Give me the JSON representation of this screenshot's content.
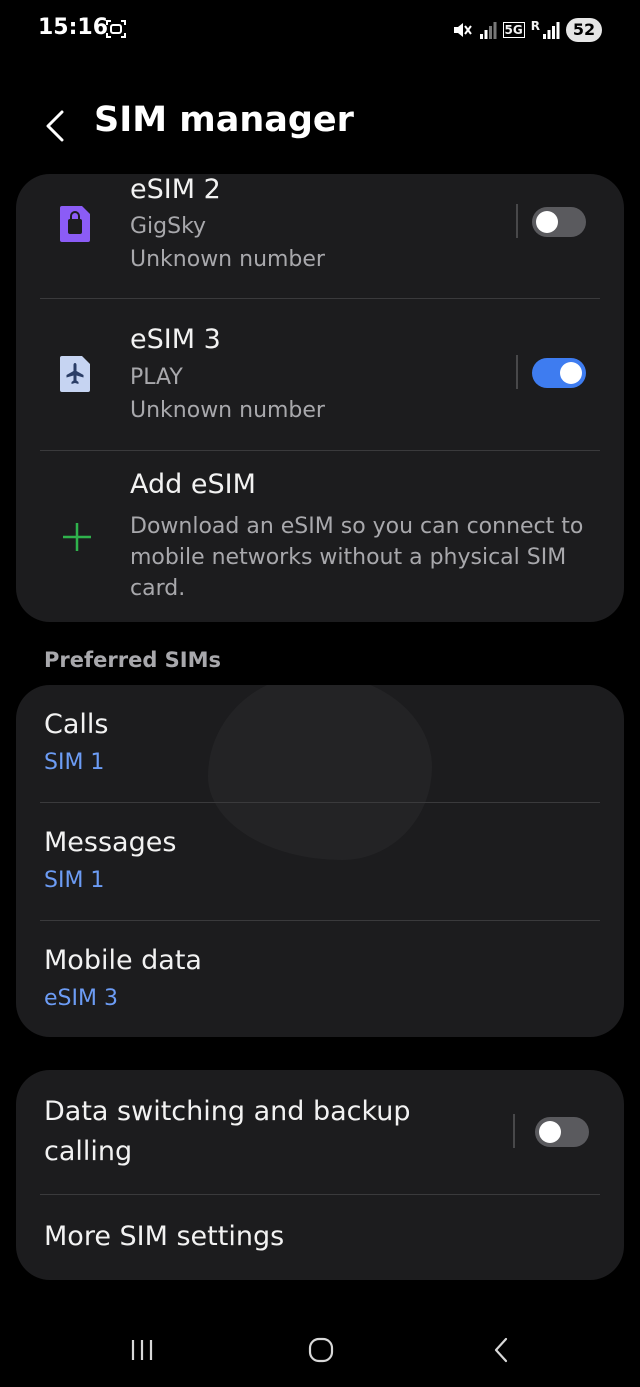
{
  "status_bar": {
    "time": "15:16",
    "battery": "52",
    "network": "5G",
    "roaming": "R"
  },
  "header": {
    "title": "SIM manager"
  },
  "sims": [
    {
      "name": "eSIM 2",
      "carrier": "GigSky",
      "number": "Unknown number",
      "enabled": false,
      "icon": "sim-card-icon",
      "icon_color": "#8b5cf6"
    },
    {
      "name": "eSIM 3",
      "carrier": "PLAY",
      "number": "Unknown number",
      "enabled": true,
      "icon": "airplane-sim-icon",
      "icon_color": "#c6d4f2"
    }
  ],
  "add_esim": {
    "title": "Add eSIM",
    "description": "Download an eSIM so you can connect to mobile networks without a physical SIM card."
  },
  "preferred": {
    "header": "Preferred SIMs",
    "items": [
      {
        "label": "Calls",
        "value": "SIM 1"
      },
      {
        "label": "Messages",
        "value": "SIM 1"
      },
      {
        "label": "Mobile data",
        "value": "eSIM 3"
      }
    ]
  },
  "settings": {
    "data_switching_label": "Data switching and backup calling",
    "data_switching_enabled": false,
    "more_label": "More SIM settings"
  },
  "colors": {
    "accent": "#3e7cf0",
    "link": "#6c9cf5",
    "add_icon": "#2fb24c",
    "card_bg": "#1c1c1e"
  }
}
